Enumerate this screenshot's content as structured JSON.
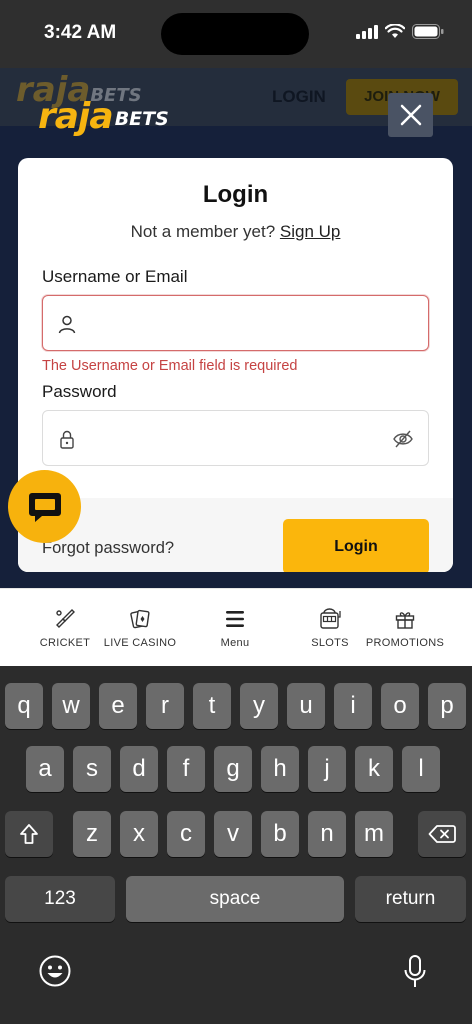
{
  "status_bar": {
    "time": "3:42 AM"
  },
  "background_site": {
    "login_label": "LOGIN",
    "join_label": "JOIN NOW"
  },
  "brand": {
    "logo_main": "raja",
    "logo_suffix": "BETS",
    "accent_color": "#fbb60c"
  },
  "modal": {
    "title": "Login",
    "signup_prompt": "Not a member yet?",
    "signup_link": "Sign Up",
    "username_label": "Username or Email",
    "username_value": "",
    "username_error": "The Username or Email field is required",
    "password_label": "Password",
    "password_value": "",
    "forgot_password": "Forgot password?",
    "login_button": "Login"
  },
  "bottom_nav": {
    "items": [
      {
        "label": "CRICKET",
        "icon": "cricket-bat-icon"
      },
      {
        "label": "LIVE CASINO",
        "icon": "playing-cards-icon"
      },
      {
        "label": "Menu",
        "icon": "hamburger-menu-icon"
      },
      {
        "label": "SLOTS",
        "icon": "slot-machine-icon"
      },
      {
        "label": "PROMOTIONS",
        "icon": "gift-icon"
      }
    ]
  },
  "keyboard": {
    "row1": [
      "q",
      "w",
      "e",
      "r",
      "t",
      "y",
      "u",
      "i",
      "o",
      "p"
    ],
    "row2": [
      "a",
      "s",
      "d",
      "f",
      "g",
      "h",
      "j",
      "k",
      "l"
    ],
    "row3": [
      "z",
      "x",
      "c",
      "v",
      "b",
      "n",
      "m"
    ],
    "numbers_key": "123",
    "space_key": "space",
    "return_key": "return"
  }
}
